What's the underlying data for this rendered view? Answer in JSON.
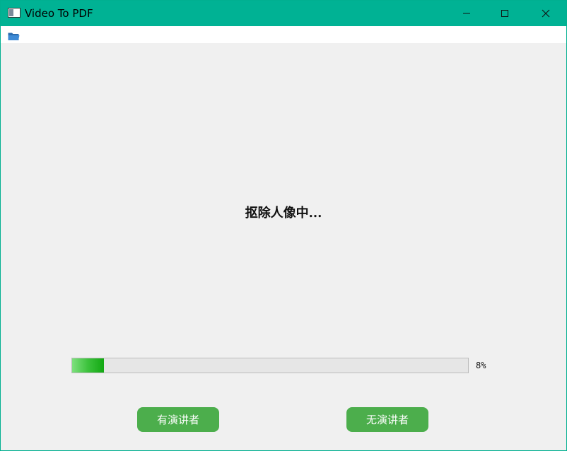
{
  "window": {
    "title": "Video To PDF",
    "accent_color": "#00b294"
  },
  "titlebar": {
    "app_icon": "app-window-icon",
    "controls": [
      "minimize-icon",
      "maximize-icon",
      "close-icon"
    ]
  },
  "toolbar": {
    "open_icon": "folder-open-icon"
  },
  "main": {
    "status_text": "抠除人像中...",
    "progress": {
      "value_fraction": 0.08,
      "label": "8%",
      "fill_color": "#22b422"
    },
    "buttons": {
      "with_speaker": "有演讲者",
      "without_speaker": "无演讲者",
      "button_color": "#4cae4c"
    }
  }
}
